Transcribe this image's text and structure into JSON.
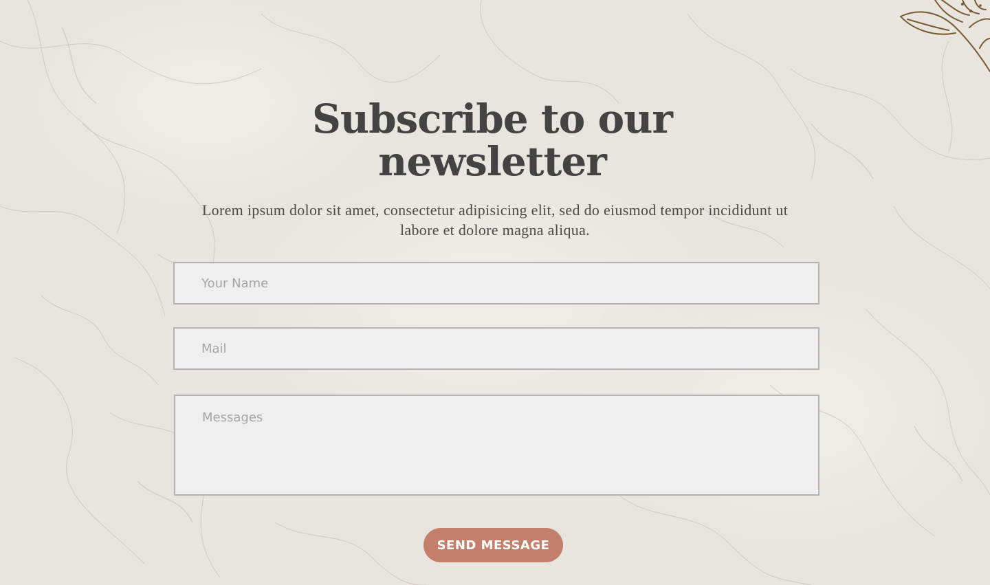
{
  "newsletter": {
    "title_line1": "Subscribe to our",
    "title_line2": "newsletter",
    "description": "Lorem ipsum dolor sit amet, consectetur adipisicing elit, sed do eiusmod tempor incididunt ut labore et dolore magna aliqua."
  },
  "form": {
    "name_placeholder": "Your Name",
    "mail_placeholder": "Mail",
    "message_placeholder": "Messages",
    "submit_label": "SEND MESSAGE"
  },
  "colors": {
    "background": "#e6e4dc",
    "title": "#434343",
    "button": "#c47f6c",
    "decoration": "#7a5a32"
  },
  "icons": {
    "corner_decoration": "leaf-branch-icon"
  }
}
